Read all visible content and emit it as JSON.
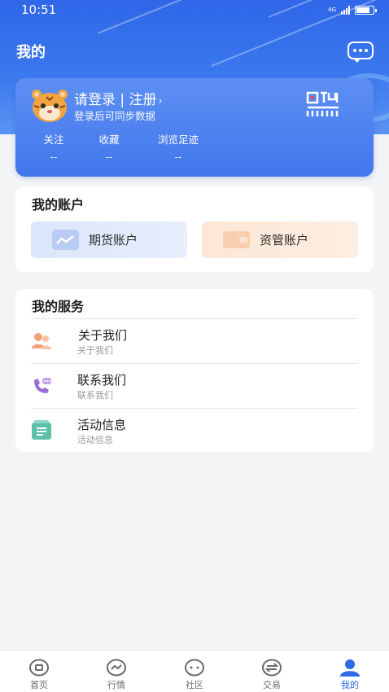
{
  "status_bar": {
    "time": "10:51",
    "network": "4G"
  },
  "header": {
    "title": "我的"
  },
  "profile": {
    "login_prefix": "请登录 | 注册",
    "login_chevron": "›",
    "subtitle": "登录后可同步数据",
    "stats": [
      {
        "label": "关注",
        "value": "--"
      },
      {
        "label": "收藏",
        "value": "--"
      },
      {
        "label": "浏览足迹",
        "value": "--"
      }
    ]
  },
  "accounts": {
    "title": "我的账户",
    "futures_label": "期货账户",
    "asset_label": "资管账户"
  },
  "services": {
    "title": "我的服务",
    "items": [
      {
        "title": "关于我们",
        "subtitle": "关于我们",
        "icon": "users-icon"
      },
      {
        "title": "联系我们",
        "subtitle": "联系我们",
        "icon": "phone-icon"
      },
      {
        "title": "活动信息",
        "subtitle": "活动信息",
        "icon": "activity-icon"
      }
    ]
  },
  "tabs": [
    {
      "label": "首页",
      "icon": "home-icon"
    },
    {
      "label": "行情",
      "icon": "market-icon"
    },
    {
      "label": "社区",
      "icon": "community-icon"
    },
    {
      "label": "交易",
      "icon": "trade-icon"
    },
    {
      "label": "我的",
      "icon": "profile-icon",
      "active": true
    }
  ],
  "colors": {
    "primary": "#2f67e8",
    "active_tab": "#2d6ae8",
    "bg": "#f3f4f6"
  }
}
